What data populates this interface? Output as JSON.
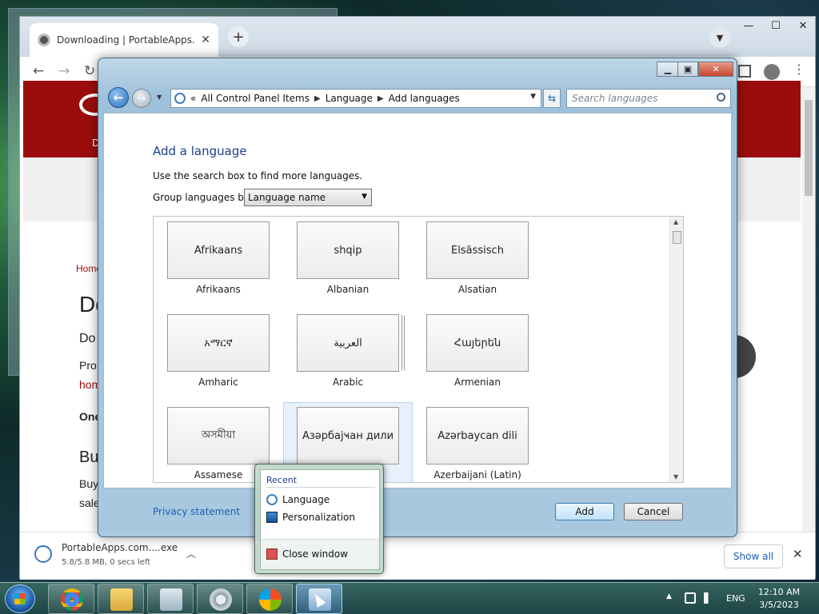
{
  "browser": {
    "tab_title": "Downloading | PortableApps.com",
    "page": {
      "banner_text": "D",
      "breadcrumb": "Home",
      "heading": "Do",
      "line1": "Do",
      "line2a": "Pro",
      "line2b": "hom",
      "line3": "One",
      "heading2": "Bu",
      "line4a": "Buy",
      "line4b": "sale"
    },
    "download": {
      "file_name": "PortableApps.com....exe",
      "status": "5.8/5.8 MB, 0 secs left",
      "show_all": "Show all"
    }
  },
  "dialog": {
    "address": {
      "chevron": "«",
      "crumbs": [
        "All Control Panel Items",
        "Language",
        "Add languages"
      ]
    },
    "search_placeholder": "Search languages",
    "heading": "Add a language",
    "instruction": "Use the search box to find more languages.",
    "group_label": "Group languages by:",
    "group_value": "Language name",
    "languages": [
      {
        "native": "Afrikaans",
        "name": "Afrikaans"
      },
      {
        "native": "shqip",
        "name": "Albanian"
      },
      {
        "native": "Elsässisch",
        "name": "Alsatian"
      },
      {
        "native": "አማርኛ",
        "name": "Amharic"
      },
      {
        "native": "العربية",
        "name": "Arabic"
      },
      {
        "native": "Հայերեն",
        "name": "Armenian"
      },
      {
        "native": "অসমীয়া",
        "name": "Assamese"
      },
      {
        "native": "Азәрбајҹан дили",
        "name": ")"
      },
      {
        "native": "Azərbaycan dili",
        "name": "Azerbaijani (Latin)"
      }
    ],
    "privacy": "Privacy statement",
    "add_button": "Add",
    "cancel_button": "Cancel"
  },
  "jumplist": {
    "header": "Recent",
    "items": [
      "Language",
      "Personalization"
    ],
    "close": "Close window"
  },
  "tray": {
    "lang": "ENG",
    "time": "12:10 AM",
    "date": "3/5/2023"
  }
}
